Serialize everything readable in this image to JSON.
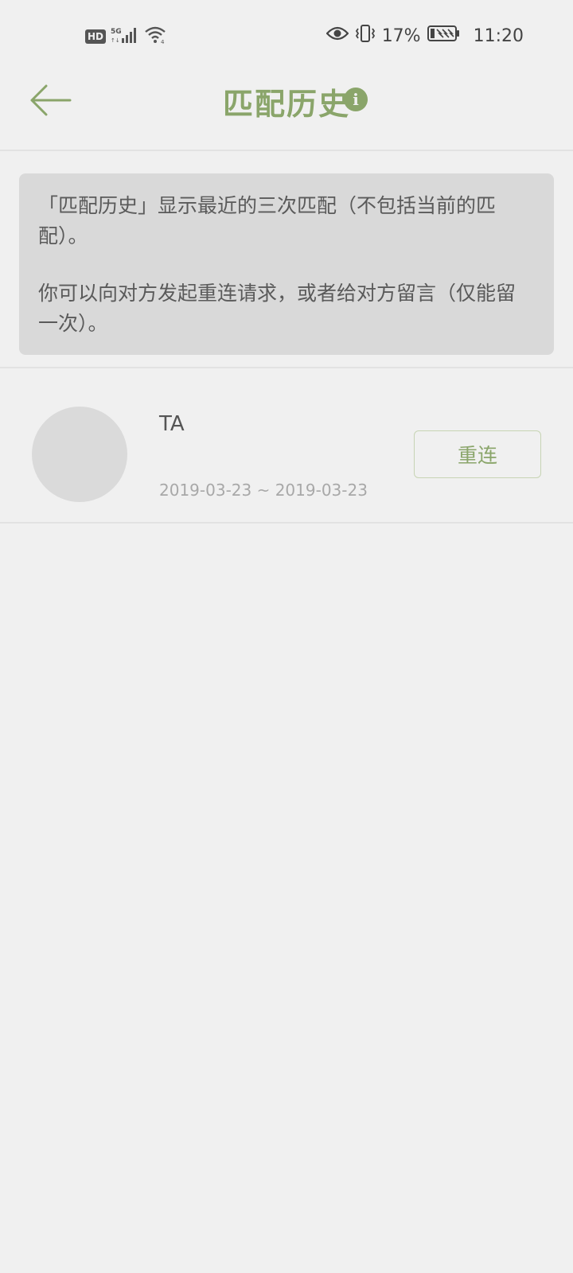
{
  "status_bar": {
    "hd": "HD",
    "network": "5G",
    "battery": "17%",
    "time": "11:20"
  },
  "header": {
    "title": "匹配历史",
    "info_symbol": "i"
  },
  "notice": {
    "line1": "「匹配历史」显示最近的三次匹配（不包括当前的匹配）。",
    "line2": "你可以向对方发起重连请求，或者给对方留言（仅能留一次）。"
  },
  "history": [
    {
      "name": "TA",
      "date_range": "2019-03-23 ~ 2019-03-23",
      "action_label": "重连"
    }
  ],
  "colors": {
    "accent": "#8aa56a",
    "background": "#f0f0f0",
    "notice_bg": "#d9d9d9"
  }
}
